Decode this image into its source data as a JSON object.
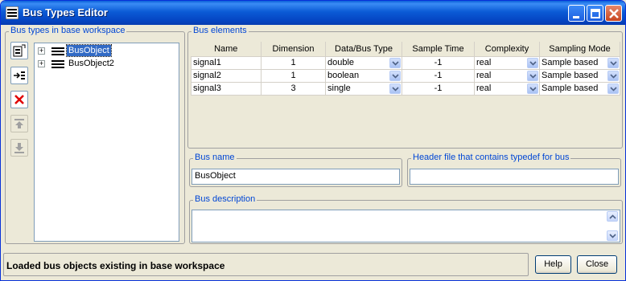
{
  "window": {
    "title": "Bus Types Editor"
  },
  "left_panel": {
    "label": "Bus types in base workspace",
    "tree": [
      {
        "label": "BusObject",
        "selected": true
      },
      {
        "label": "BusObject2",
        "selected": false
      }
    ]
  },
  "bus_elements": {
    "label": "Bus elements",
    "columns": [
      "Name",
      "Dimension",
      "Data/Bus Type",
      "Sample Time",
      "Complexity",
      "Sampling Mode"
    ],
    "rows": [
      {
        "name": "signal1",
        "dimension": "1",
        "type": "double",
        "sample_time": "-1",
        "complexity": "real",
        "sampling_mode": "Sample based"
      },
      {
        "name": "signal2",
        "dimension": "1",
        "type": "boolean",
        "sample_time": "-1",
        "complexity": "real",
        "sampling_mode": "Sample based"
      },
      {
        "name": "signal3",
        "dimension": "3",
        "type": "single",
        "sample_time": "-1",
        "complexity": "real",
        "sampling_mode": "Sample based"
      }
    ]
  },
  "bus_name": {
    "label": "Bus name",
    "value": "BusObject"
  },
  "header_file": {
    "label": "Header file that contains typedef for bus",
    "value": ""
  },
  "bus_description": {
    "label": "Bus description",
    "value": ""
  },
  "status": {
    "text": "Loaded bus objects existing in base workspace"
  },
  "buttons": {
    "help": "Help",
    "close": "Close"
  }
}
